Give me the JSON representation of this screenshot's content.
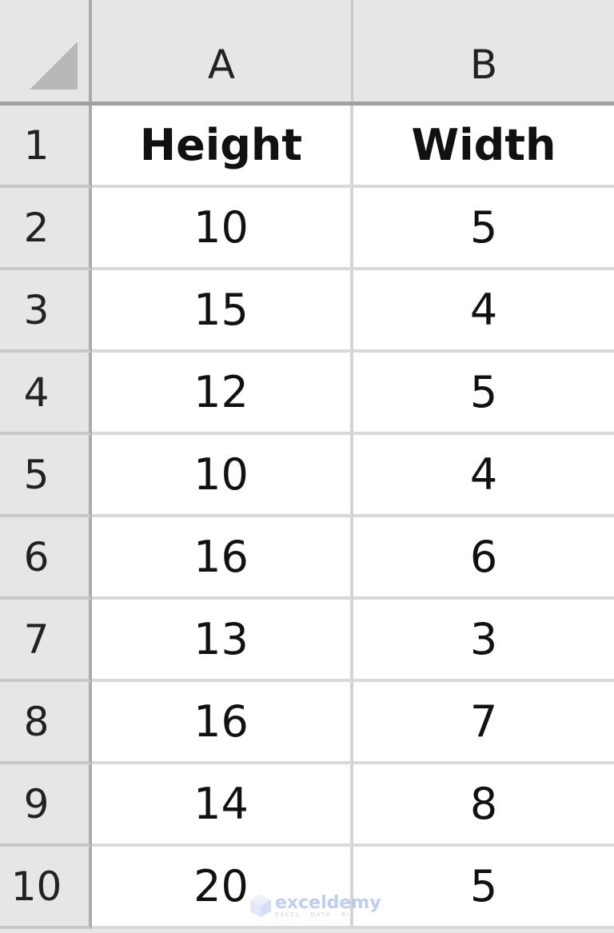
{
  "spreadsheet": {
    "columns": [
      "A",
      "B"
    ],
    "rows": [
      {
        "num": "1",
        "a": "Height",
        "b": "Width",
        "header": true
      },
      {
        "num": "2",
        "a": "10",
        "b": "5"
      },
      {
        "num": "3",
        "a": "15",
        "b": "4"
      },
      {
        "num": "4",
        "a": "12",
        "b": "5"
      },
      {
        "num": "5",
        "a": "10",
        "b": "4"
      },
      {
        "num": "6",
        "a": "16",
        "b": "6"
      },
      {
        "num": "7",
        "a": "13",
        "b": "3"
      },
      {
        "num": "8",
        "a": "16",
        "b": "7"
      },
      {
        "num": "9",
        "a": "14",
        "b": "8"
      },
      {
        "num": "10",
        "a": "20",
        "b": "5"
      }
    ]
  },
  "watermark": {
    "brand": "exceldemy",
    "tagline": "EXCEL · DATA · BI",
    "icon": "exceldemy-logo-icon"
  }
}
